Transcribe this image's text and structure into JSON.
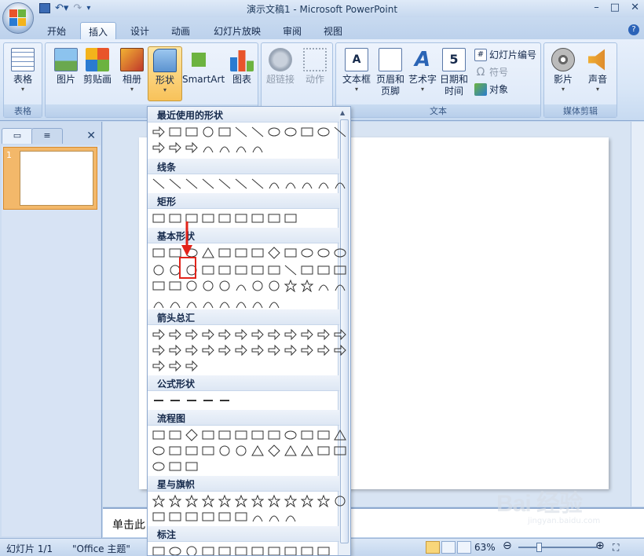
{
  "app": {
    "title": "演示文稿1 - Microsoft PowerPoint",
    "help": "?"
  },
  "tabs": [
    {
      "label": "开始",
      "active": false
    },
    {
      "label": "插入",
      "active": true
    },
    {
      "label": "设计",
      "active": false
    },
    {
      "label": "动画",
      "active": false
    },
    {
      "label": "幻灯片放映",
      "active": false
    },
    {
      "label": "审阅",
      "active": false
    },
    {
      "label": "视图",
      "active": false
    }
  ],
  "ribbon": {
    "groups": {
      "tables": {
        "label": "表格",
        "table": "表格"
      },
      "illustrations": {
        "label": "插",
        "picture": "图片",
        "clipart": "剪贴画",
        "album": "相册",
        "shapes": "形状",
        "smartart": "SmartArt",
        "chart": "图表"
      },
      "links": {
        "hyperlink": "超链接",
        "action": "动作"
      },
      "text": {
        "label": "文本",
        "textbox": "文本框",
        "header_footer": "页眉和页脚",
        "wordart": "艺术字",
        "datetime": "日期和时间",
        "slide_number": "幻灯片编号",
        "symbol": "符号",
        "object": "对象"
      },
      "media": {
        "label": "媒体剪辑",
        "movie": "影片",
        "sound": "声音"
      }
    }
  },
  "left_panel": {
    "slide_number": "1",
    "close": "✕"
  },
  "notes": {
    "placeholder": "单击此"
  },
  "status": {
    "slide": "幻灯片 1/1",
    "theme": "\"Office 主题\"",
    "zoom": "63%"
  },
  "shapes_menu": {
    "categories": [
      {
        "label": "最近使用的形状"
      },
      {
        "label": "线条"
      },
      {
        "label": "矩形"
      },
      {
        "label": "基本形状"
      },
      {
        "label": "箭头总汇"
      },
      {
        "label": "公式形状"
      },
      {
        "label": "流程图"
      },
      {
        "label": "星与旗帜"
      },
      {
        "label": "标注"
      }
    ]
  },
  "watermark": {
    "text": "Bai 经验",
    "sub": "jingyan.baidu.com"
  },
  "colors": {
    "accent": "#f8c25a",
    "highlight": "#e2231a"
  }
}
